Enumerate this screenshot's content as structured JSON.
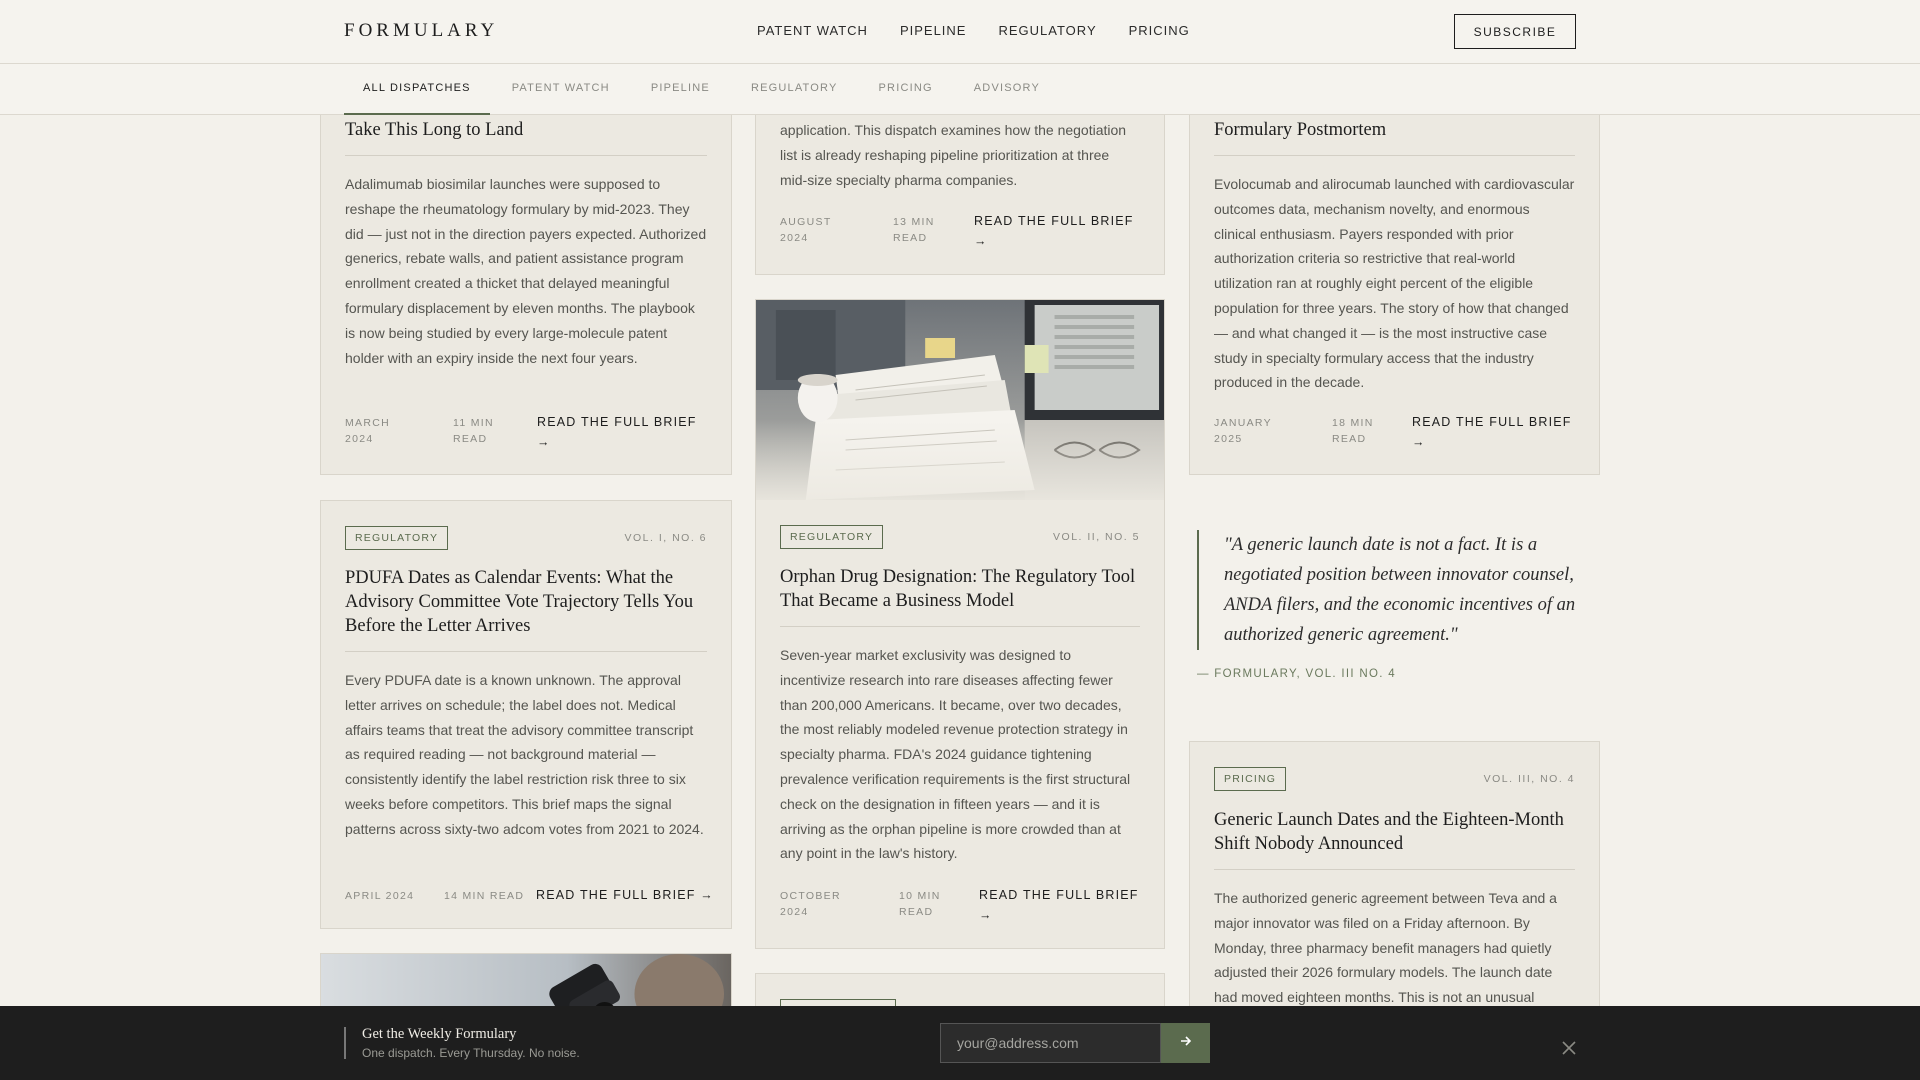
{
  "header": {
    "brand": "FORMULARY",
    "nav": [
      "PATENT WATCH",
      "PIPELINE",
      "REGULATORY",
      "PRICING"
    ],
    "subscribe_label": "SUBSCRIBE"
  },
  "tabs": [
    "ALL DISPATCHES",
    "PATENT WATCH",
    "PIPELINE",
    "REGULATORY",
    "PRICING",
    "ADVISORY"
  ],
  "active_tab": "ALL DISPATCHES",
  "cards": {
    "c1": {
      "headline": "Take This Long to Land",
      "body": "Adalimumab biosimilar launches were supposed to reshape the rheumatology formulary by mid-2023. They did — just not in the direction payers expected. Authorized generics, rebate walls, and patient assistance program enrollment created a thicket that delayed meaningful formulary displacement by eleven months. The playbook is now being studied by every large-molecule patent holder with an expiry inside the next four years.",
      "date": "MARCH 2024",
      "read": "11 MIN READ",
      "link": "READ THE FULL BRIEF →"
    },
    "c2": {
      "body": "application. This dispatch examines how the negotiation list is already reshaping pipeline prioritization at three mid-size specialty pharma companies.",
      "date": "AUGUST 2024",
      "read": "13 MIN READ",
      "link": "READ THE FULL BRIEF →"
    },
    "c3": {
      "headline": "Formulary Postmortem",
      "body": "Evolocumab and alirocumab launched with cardiovascular outcomes data, mechanism novelty, and enormous clinical enthusiasm. Payers responded with prior authorization criteria so restrictive that real-world utilization ran at roughly eight percent of the eligible population for three years. The story of how that changed — and what changed it — is the most instructive case study in specialty formulary access that the industry produced in the decade.",
      "date": "JANUARY 2025",
      "read": "18 MIN READ",
      "link": "READ THE FULL BRIEF →"
    },
    "c4": {
      "tag": "REGULATORY",
      "vol": "VOL. I, NO. 6",
      "headline": "PDUFA Dates as Calendar Events: What the Advisory Committee Vote Trajectory Tells You Before the Letter Arrives",
      "body": "Every PDUFA date is a known unknown. The approval letter arrives on schedule; the label does not. Medical affairs teams that treat the advisory committee transcript as required reading — not background material — consistently identify the label restriction risk three to six weeks before competitors. This brief maps the signal patterns across sixty-two adcom votes from 2021 to 2024.",
      "date": "APRIL 2024",
      "read": "14 MIN READ",
      "link": "READ THE FULL BRIEF →"
    },
    "c5": {
      "tag": "REGULATORY",
      "vol": "VOL. II, NO. 5",
      "headline": "Orphan Drug Designation: The Regulatory Tool That Became a Business Model",
      "body": "Seven-year market exclusivity was designed to incentivize research into rare diseases affecting fewer than 200,000 Americans. It became, over two decades, the most reliably modeled revenue protection strategy in specialty pharma. FDA's 2024 guidance tightening prevalence verification requirements is the first structural check on the designation in fifteen years — and it is arriving as the orphan pipeline is more crowded than at any point in the law's history.",
      "date": "OCTOBER 2024",
      "read": "10 MIN READ",
      "link": "READ THE FULL BRIEF →"
    },
    "c6": {
      "tag": "PRICING",
      "vol": "VOL. III, NO. 4",
      "headline": "Generic Launch Dates and the Eighteen-Month Shift Nobody Announced",
      "body": "The authorized generic agreement between Teva and a major innovator was filed on a Friday afternoon. By Monday, three pharmacy benefit managers had quietly adjusted their 2026 formulary models. The launch date had moved eighteen months. This is not an unusual"
    }
  },
  "quote": {
    "text": "\"A generic launch date is not a fact. It is a negotiated position between innovator counsel, ANDA filers, and the economic incentives of an authorized generic agreement.\"",
    "source": "— FORMULARY, VOL. III NO. 4"
  },
  "banner": {
    "title": "Get the Weekly Formulary",
    "subtitle": "One dispatch. Every Thursday. No noise.",
    "email_placeholder": "your@address.com",
    "submit_icon": "arrow-right-icon",
    "close_icon": "close-icon"
  },
  "colors": {
    "background": "#f3f1eb",
    "card": "#ece9e1",
    "accent": "#5b6b4e",
    "banner": "#1e1e1e"
  }
}
